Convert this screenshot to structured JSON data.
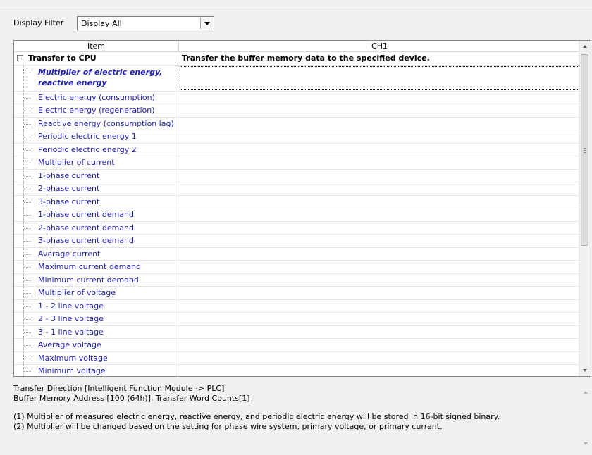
{
  "filter": {
    "label": "Display Filter",
    "value": "Display All"
  },
  "grid": {
    "columns": [
      "Item",
      "CH1"
    ],
    "group": {
      "label": "Transfer to CPU",
      "value": "Transfer the buffer memory data to the specified device."
    },
    "selected_item": "Multiplier of electric energy, reactive energy",
    "items": [
      "Electric energy (consumption)",
      "Electric energy (regeneration)",
      "Reactive energy (consumption lag)",
      "Periodic electric energy 1",
      "Periodic electric energy 2",
      "Multiplier of current",
      "1-phase current",
      "2-phase current",
      "3-phase current",
      "1-phase current demand",
      "2-phase current demand",
      "3-phase current demand",
      "Average current",
      "Maximum current demand",
      "Minimum current demand",
      "Multiplier of voltage",
      "1 - 2 line voltage",
      "2 - 3 line voltage",
      "3 - 1 line voltage",
      "Average voltage",
      "Maximum voltage",
      "Minimum voltage"
    ]
  },
  "description": {
    "line1": "Transfer Direction [Intelligent Function Module -> PLC]",
    "line2": "Buffer Memory Address [100 (64h)], Transfer Word Counts[1]",
    "line3": "(1) Multiplier of measured electric energy, reactive energy, and periodic electric energy will be stored in 16-bit signed binary.",
    "line4": "(2) Multiplier will be changed based on the setting for phase wire system, primary voltage, or primary current."
  }
}
